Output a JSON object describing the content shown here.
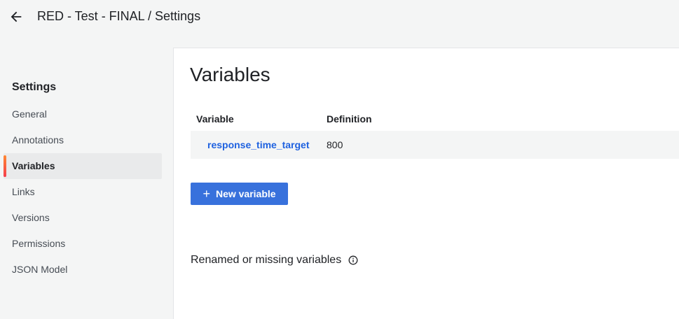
{
  "header": {
    "breadcrumb": "RED - Test - FINAL / Settings",
    "back_icon": "arrow-left-icon"
  },
  "sidebar": {
    "title": "Settings",
    "items": [
      {
        "label": "General",
        "active": false
      },
      {
        "label": "Annotations",
        "active": false
      },
      {
        "label": "Variables",
        "active": true
      },
      {
        "label": "Links",
        "active": false
      },
      {
        "label": "Versions",
        "active": false
      },
      {
        "label": "Permissions",
        "active": false
      },
      {
        "label": "JSON Model",
        "active": false
      }
    ]
  },
  "main": {
    "title": "Variables",
    "table": {
      "headers": [
        "Variable",
        "Definition"
      ],
      "rows": [
        {
          "variable": "response_time_target",
          "definition": "800"
        }
      ]
    },
    "new_variable_label": "New variable",
    "missing_section_label": "Renamed or missing variables",
    "info_icon": "info-circle-icon"
  },
  "colors": {
    "accent": "#3871dc",
    "link": "#1f62e0",
    "active_indicator_start": "#ff8833",
    "active_indicator_end": "#f53e4c"
  }
}
